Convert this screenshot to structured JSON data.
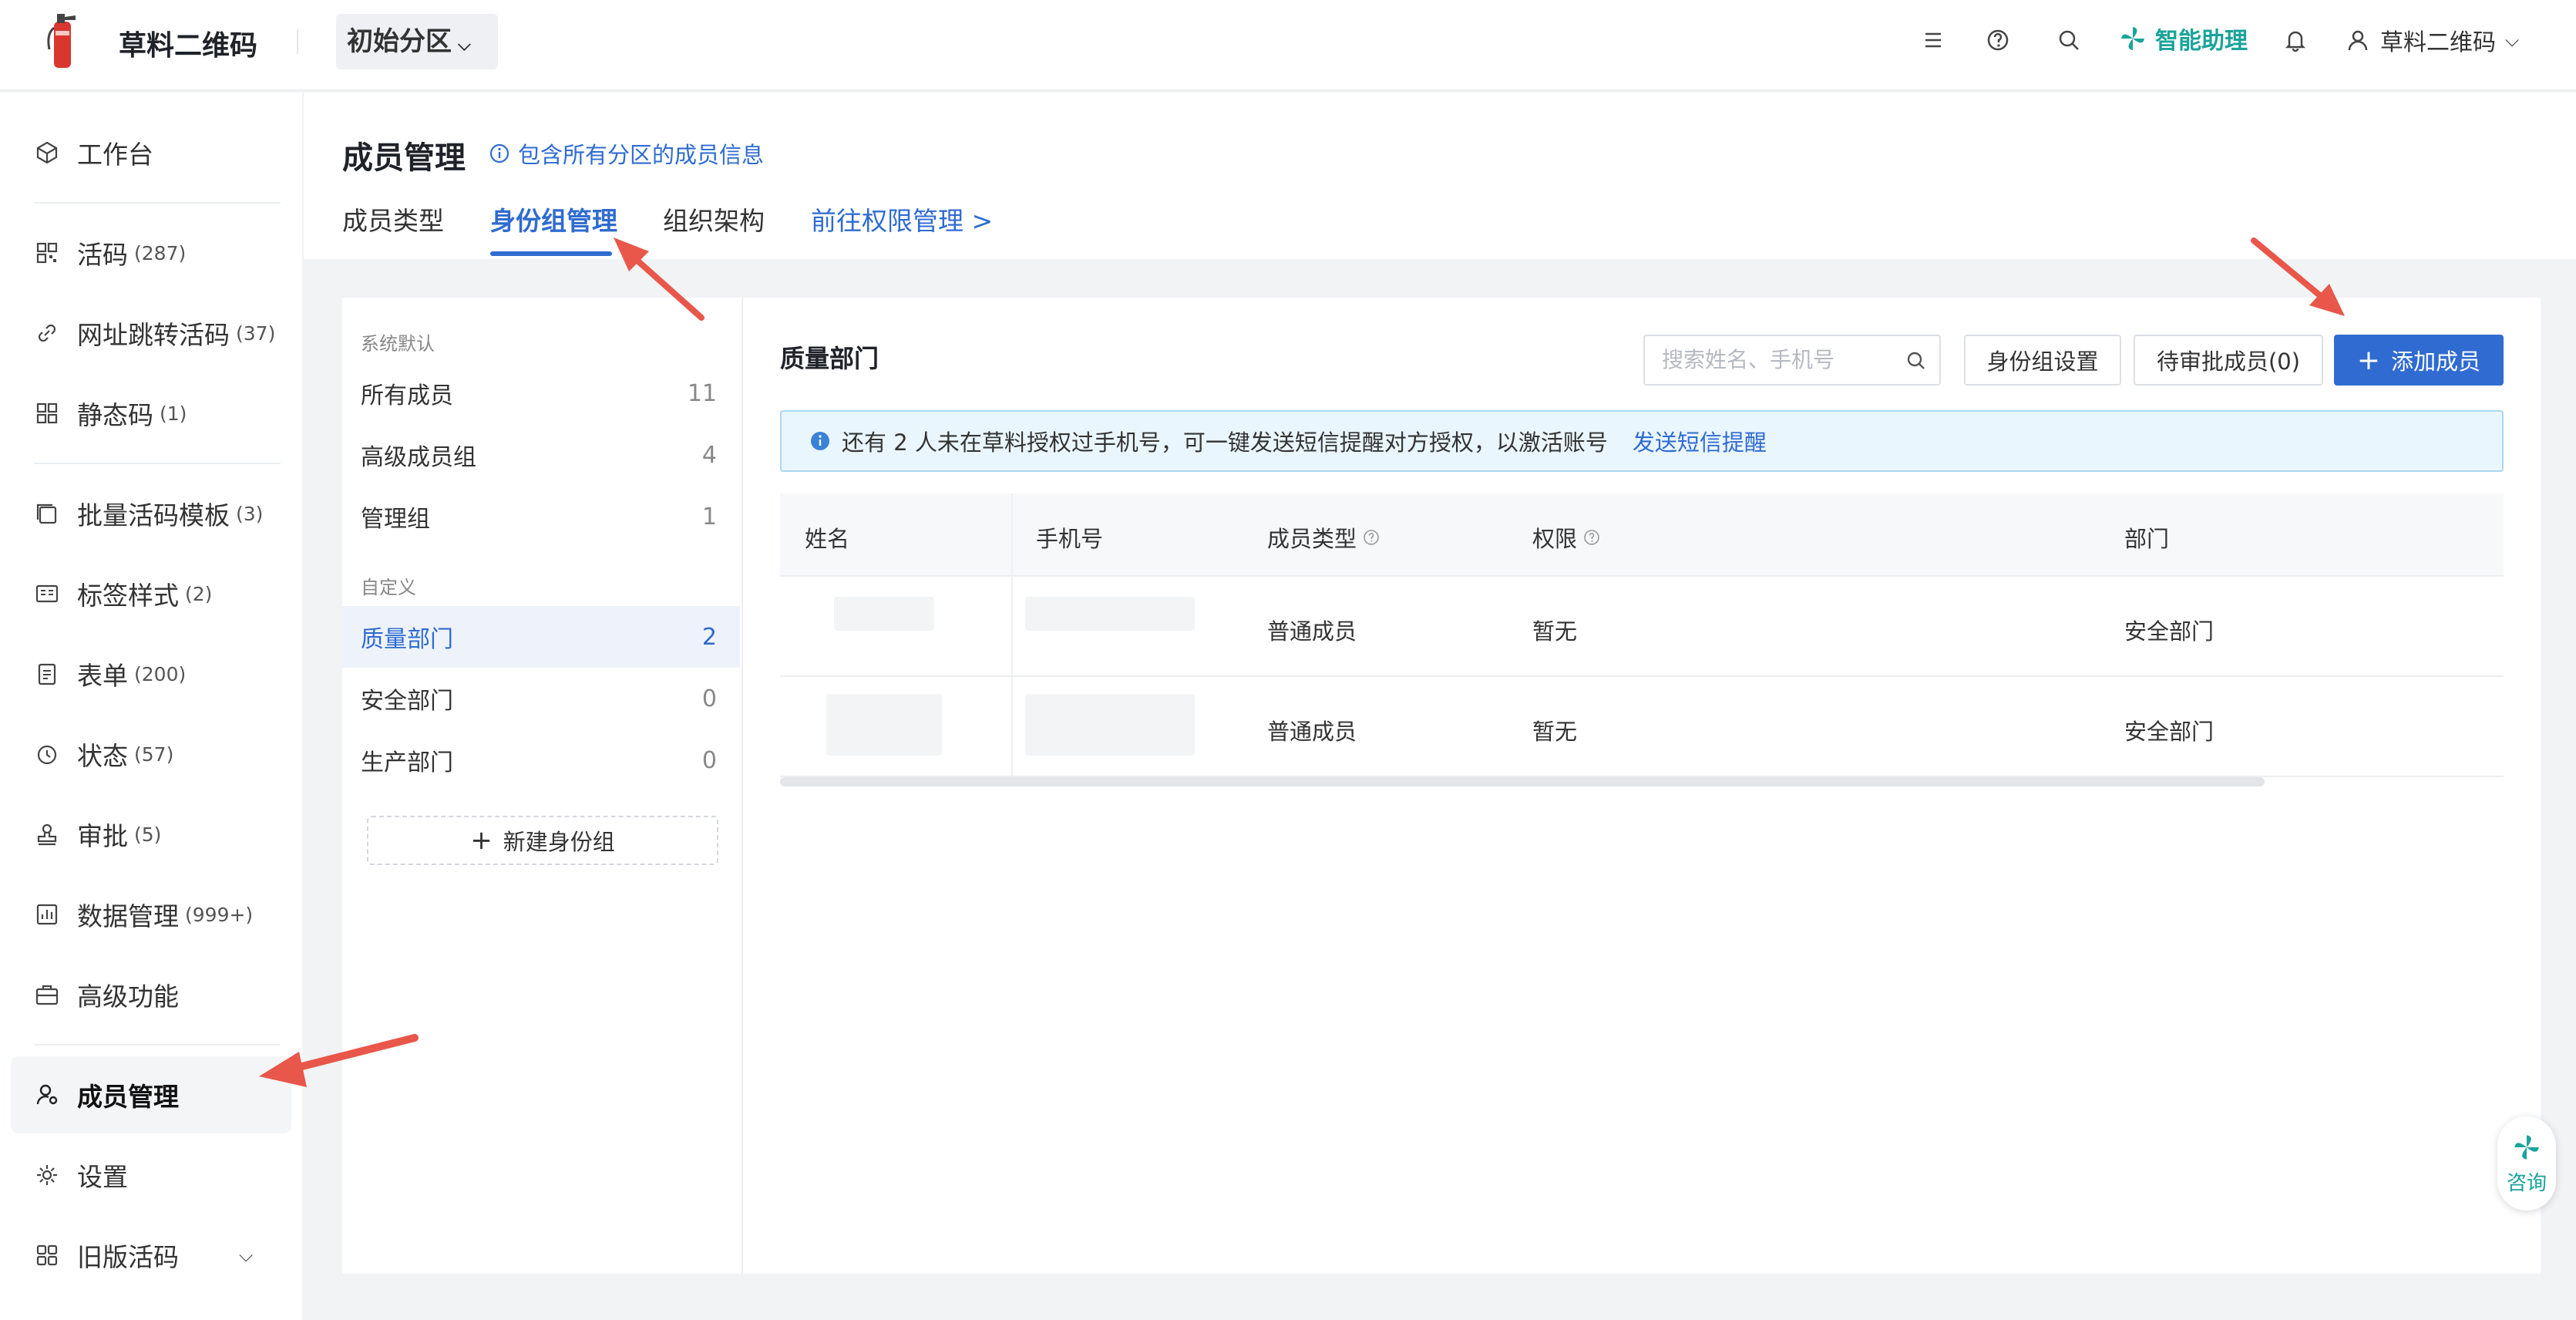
{
  "header": {
    "brand": "草料二维码",
    "partition": "初始分区",
    "assistant": "智能助理",
    "user": "草料二维码"
  },
  "sidebar": {
    "items": [
      {
        "label": "工作台",
        "count": "",
        "icon": "cube-icon"
      },
      {
        "label": "活码",
        "count": "(287)",
        "icon": "qrcode-icon"
      },
      {
        "label": "网址跳转活码",
        "count": "(37)",
        "icon": "link-icon"
      },
      {
        "label": "静态码",
        "count": "(1)",
        "icon": "grid-icon"
      },
      {
        "label": "批量活码模板",
        "count": "(3)",
        "icon": "stack-icon"
      },
      {
        "label": "标签样式",
        "count": "(2)",
        "icon": "label-icon"
      },
      {
        "label": "表单",
        "count": "(200)",
        "icon": "form-icon"
      },
      {
        "label": "状态",
        "count": "(57)",
        "icon": "status-icon"
      },
      {
        "label": "审批",
        "count": "(5)",
        "icon": "stamp-icon"
      },
      {
        "label": "数据管理",
        "count": "(999+)",
        "icon": "chart-icon"
      },
      {
        "label": "高级功能",
        "count": "",
        "icon": "briefcase-icon"
      },
      {
        "label": "成员管理",
        "count": "",
        "icon": "member-icon"
      },
      {
        "label": "设置",
        "count": "",
        "icon": "gear-icon"
      },
      {
        "label": "旧版活码",
        "count": "",
        "icon": "apps-icon"
      }
    ]
  },
  "page": {
    "title": "成员管理",
    "info": "包含所有分区的成员信息",
    "tabs": [
      "成员类型",
      "身份组管理",
      "组织架构",
      "前往权限管理 >"
    ]
  },
  "groups": {
    "system_label": "系统默认",
    "custom_label": "自定义",
    "system": [
      {
        "name": "所有成员",
        "count": "11"
      },
      {
        "name": "高级成员组",
        "count": "4"
      },
      {
        "name": "管理组",
        "count": "1"
      }
    ],
    "custom": [
      {
        "name": "质量部门",
        "count": "2"
      },
      {
        "name": "安全部门",
        "count": "0"
      },
      {
        "name": "生产部门",
        "count": "0"
      }
    ],
    "new_button": "新建身份组"
  },
  "main": {
    "title": "质量部门",
    "search_placeholder": "搜索姓名、手机号",
    "btn_group_settings": "身份组设置",
    "btn_pending": "待审批成员(0)",
    "btn_add": "添加成员",
    "alert_text": "还有 2 人未在草料授权过手机号，可一键发送短信提醒对方授权，以激活账号",
    "alert_link": "发送短信提醒",
    "columns": [
      "姓名",
      "手机号",
      "成员类型",
      "权限",
      "部门"
    ],
    "rows": [
      {
        "type": "普通成员",
        "perm": "暂无",
        "dept": "安全部门"
      },
      {
        "type": "普通成员",
        "perm": "暂无",
        "dept": "安全部门"
      }
    ]
  },
  "consult": "咨询",
  "colors": {
    "primary": "#2f6bd0",
    "assistant": "#1aa39a",
    "arrow": "#e8574a"
  }
}
